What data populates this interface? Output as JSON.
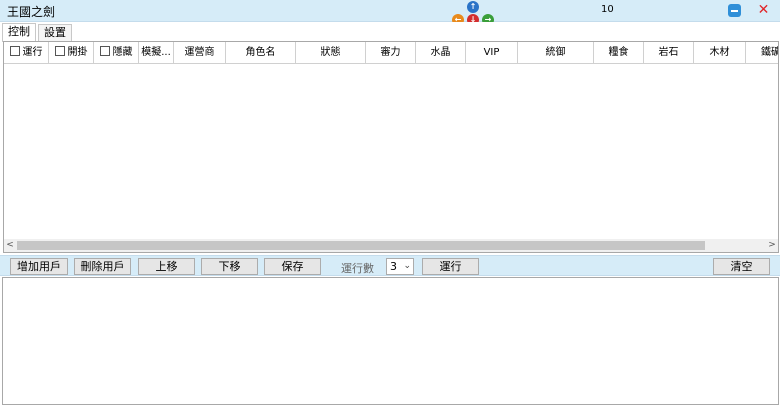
{
  "window": {
    "title": "王國之劍",
    "counter": "10"
  },
  "icons": {
    "up": "arrow-up-icon",
    "down": "arrow-down-icon",
    "left": "arrow-left-icon",
    "right": "arrow-right-icon",
    "minimize": "minimize-icon",
    "close": "close-icon"
  },
  "tabs": [
    {
      "label": "控制"
    },
    {
      "label": "設置"
    }
  ],
  "grid": {
    "columns": [
      {
        "label": "運行",
        "checkbox": true
      },
      {
        "label": "開掛",
        "checkbox": true
      },
      {
        "label": "隱藏",
        "checkbox": true
      },
      {
        "label": "模擬..."
      },
      {
        "label": "運營商"
      },
      {
        "label": "角色名"
      },
      {
        "label": "狀態"
      },
      {
        "label": "審力"
      },
      {
        "label": "水晶"
      },
      {
        "label": "VIP"
      },
      {
        "label": "統御"
      },
      {
        "label": "糧食"
      },
      {
        "label": "岩石"
      },
      {
        "label": "木材"
      },
      {
        "label": "鐵礦"
      }
    ],
    "rows": []
  },
  "toolbar": {
    "add_user": "增加用戶",
    "delete_user": "刪除用戶",
    "move_up": "上移",
    "move_down": "下移",
    "save": "保存",
    "run_count_label": "運行數",
    "run_count_value": "3",
    "run": "運行",
    "clear": "清空"
  },
  "colors": {
    "titlebar": "#d6ecf8",
    "arrow_up": "#2a73c7",
    "arrow_left": "#e88a1c",
    "arrow_down": "#d32d2d",
    "arrow_right": "#3a9e3a",
    "minimize": "#2f8fd8",
    "close": "#e0262b"
  }
}
